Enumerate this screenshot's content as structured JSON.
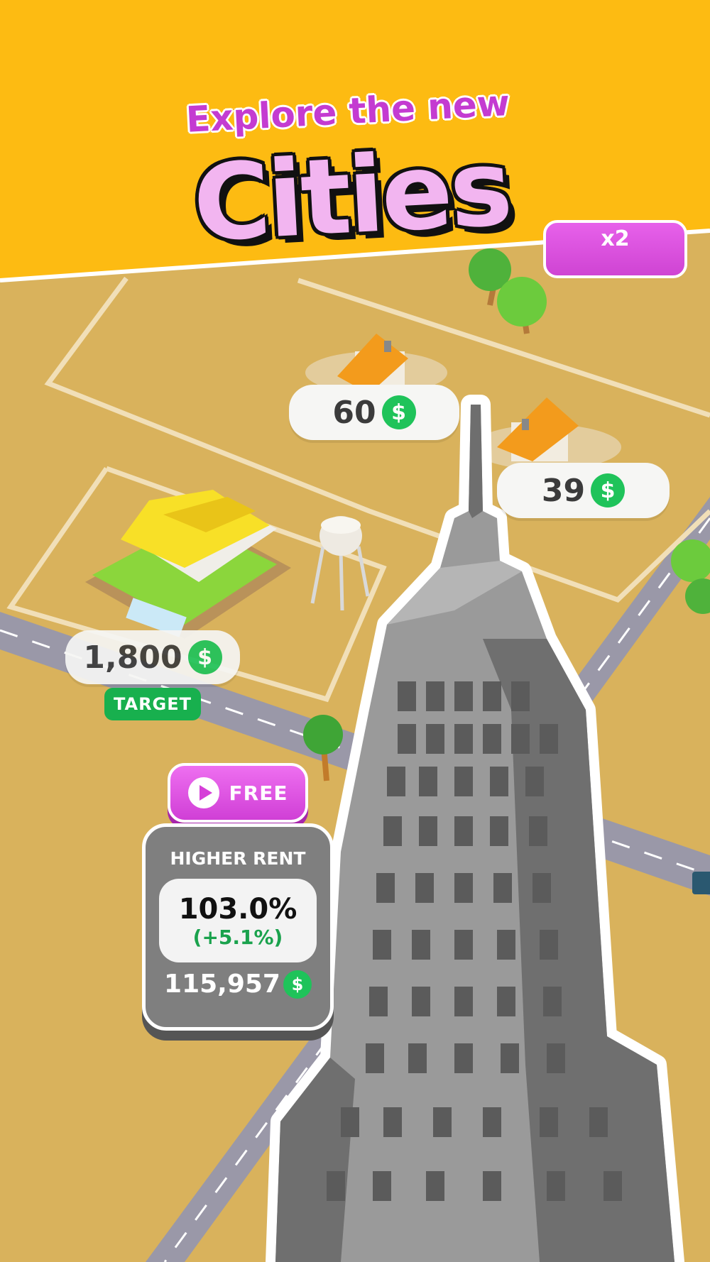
{
  "headline": {
    "subtitle": "Explore the new",
    "title": "Cities"
  },
  "colors": {
    "sky": "#fdbb12",
    "ground": "#d9b25c",
    "road": "#9a98a8",
    "coin": "#1fc35a",
    "accent": "#d03fd6",
    "card": "#7f7f7f"
  },
  "plots": [
    {
      "price": "60",
      "currency_icon": "dollar-coin-icon"
    },
    {
      "price": "39",
      "currency_icon": "dollar-coin-icon"
    },
    {
      "price": "1,800",
      "currency_icon": "dollar-coin-icon",
      "badge": "TARGET"
    }
  ],
  "free_button": {
    "label": "FREE",
    "icon": "play-icon"
  },
  "upgrade_card": {
    "title": "HIGHER RENT",
    "percent": "103.0%",
    "delta": "(+5.1%)",
    "cost": "115,957",
    "currency_icon": "dollar-coin-icon"
  },
  "multiplier_button": {
    "label": "x2"
  }
}
